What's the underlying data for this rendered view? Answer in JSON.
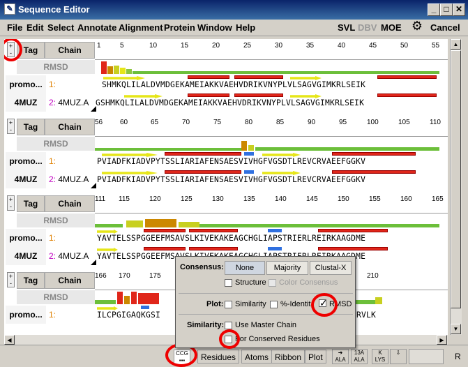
{
  "window": {
    "title": "Sequence Editor"
  },
  "menu": {
    "items": [
      "File",
      "Edit",
      "Select",
      "Annotate",
      "Alignment",
      "Protein",
      "Window",
      "Help"
    ]
  },
  "toolbar": {
    "svl": "SVL",
    "dbv": "DBV",
    "moe": "MOE",
    "cancel": "Cancel",
    "gear_icon": "gear-icon"
  },
  "columns": {
    "tag": "Tag",
    "chain": "Chain"
  },
  "rmsd_label": "RMSD",
  "rows": [
    {
      "tag": "promo...",
      "chain_num": "1:",
      "chain_name": ""
    },
    {
      "tag": "4MUZ",
      "chain_num": "2:",
      "chain_name": "4MUZ.A"
    }
  ],
  "blocks": [
    {
      "ticks": [
        "1",
        "5",
        "10",
        "15",
        "20",
        "25",
        "30",
        "35",
        "40",
        "45",
        "50",
        "55"
      ],
      "seq1": "SHMKQLILALDVMDGEKAMEIAKKVAEHVDRIKVNYPLVLSAGVGIMKRLSEIK",
      "seq2": "GSHMKQLILALDVMDGEKAMEIAKKVAEHVDRIKVNYPLVLSAGVGIMKRLSEIK"
    },
    {
      "ticks": [
        "56",
        "60",
        "65",
        "70",
        "75",
        "80",
        "85",
        "90",
        "95",
        "100",
        "105",
        "110"
      ],
      "seq1": "PVIADFKIADVPYTSSLIARIAFENSAESVIVHGFVGSDTLREVCRVAEEFGGKV",
      "seq2": "PVIADFKIADVPYTSSLIARIAFENSAESVIVHGFVGSDTLREVCRVAEEFGGKV"
    },
    {
      "ticks": [
        "111",
        "115",
        "120",
        "125",
        "130",
        "135",
        "140",
        "145",
        "150",
        "155",
        "160",
        "165"
      ],
      "seq1": "YAVTELSSPGGEEFMSAVSLKIVEKAKEAGCHGLIAPSTRIERLREIRKAAGDME",
      "seq2": "YAVTELSSPGGEEFMSAVSLKIVEKAKEAGCHGLIAPSTRIERLREIRKAAGDME"
    },
    {
      "ticks": [
        "166",
        "170",
        "175",
        "",
        "",
        "",
        "",
        "",
        "",
        "210",
        "",
        ""
      ],
      "seq1": "ILCPGIGAQKGSI",
      "seq1_tail": "RVLK",
      "seq2": ""
    }
  ],
  "bottom": {
    "ccg": "CCG",
    "buttons": [
      "Residues",
      "Atoms",
      "Ribbon",
      "Plot"
    ],
    "ala": "ALA",
    "ala13": "13A",
    "r": "R"
  },
  "popup": {
    "consensus_label": "Consensus:",
    "consensus_options": [
      "None",
      "Majority",
      "Clustal-X"
    ],
    "consensus_selected": "None",
    "structure": "Structure",
    "color_consensus": "Color Consensus",
    "plot_label": "Plot:",
    "similarity": "Similarity",
    "pct_identity": "%-Identit",
    "rmsd": "RMSD",
    "similarity_label": "Similarity:",
    "use_master": "Use Master Chain",
    "for_conserved": "For Conserved Residues"
  }
}
